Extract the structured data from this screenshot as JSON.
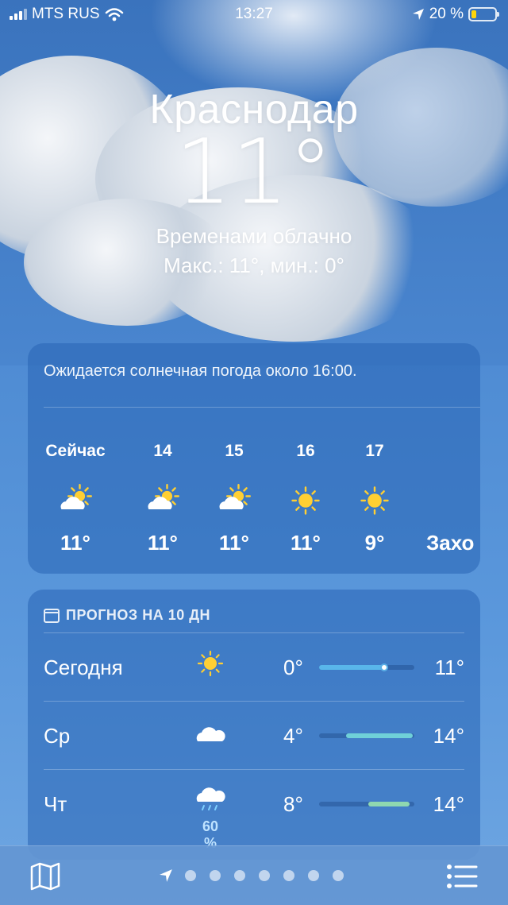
{
  "status": {
    "carrier": "MTS RUS",
    "time": "13:27",
    "battery": "20 %",
    "battery_level": 0.2
  },
  "header": {
    "city": "Краснодар",
    "temperature": "11°",
    "condition": "Временами облачно",
    "hilo": "Макс.: 11°, мин.: 0°"
  },
  "hourly": {
    "notice": "Ожидается солнечная погода около 16:00.",
    "items": [
      {
        "hour": "Сейчас",
        "icon": "partly-sunny-icon",
        "temp": "11°"
      },
      {
        "hour": "14",
        "icon": "partly-sunny-icon",
        "temp": "11°"
      },
      {
        "hour": "15",
        "icon": "partly-sunny-icon",
        "temp": "11°"
      },
      {
        "hour": "16",
        "icon": "sun-icon",
        "temp": "11°"
      },
      {
        "hour": "17",
        "icon": "sun-icon",
        "temp": "9°"
      }
    ],
    "extra": "Захо"
  },
  "daily": {
    "title": "ПРОГНОЗ НА 10 ДН",
    "rows": [
      {
        "day": "Сегодня",
        "icon": "sun-icon",
        "precip": "",
        "low": "0°",
        "high": "11°",
        "range": [
          0.0,
          0.7
        ],
        "current": 0.68,
        "color": "#59b6ea"
      },
      {
        "day": "Ср",
        "icon": "cloud-icon",
        "precip": "",
        "low": "4°",
        "high": "14°",
        "range": [
          0.28,
          0.98
        ],
        "color": "#6fd0d8"
      },
      {
        "day": "Чт",
        "icon": "rain-icon",
        "precip": "60 %",
        "low": "8°",
        "high": "14°",
        "range": [
          0.52,
          0.95
        ],
        "color": "#8fd8b0"
      }
    ]
  },
  "colors": {
    "sun": "#ffcf33",
    "cloud": "#ffffff",
    "accent": "#4a86cf"
  },
  "pager": {
    "pages": 7
  }
}
